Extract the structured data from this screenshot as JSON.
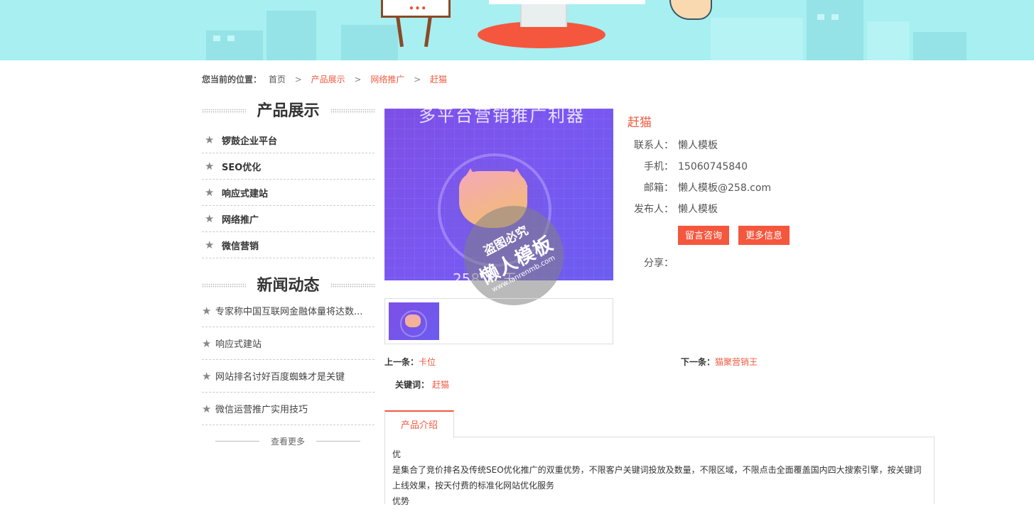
{
  "breadcrumb": {
    "label": "您当前的位置：",
    "items": [
      "首页",
      "产品展示",
      "网络推广",
      "赶猫"
    ],
    "separator": ">"
  },
  "sidebar": {
    "products_title": "产品展示",
    "products": [
      "锣鼓企业平台",
      "SEO优化",
      "响应式建站",
      "网络推广",
      "微信营销"
    ],
    "news_title": "新闻动态",
    "news": [
      "专家称中国互联网金融体量将达数...",
      "响应式建站",
      "网站排名讨好百度蜘蛛才是关键",
      "微信运营推广实用技巧"
    ],
    "more_label": "查看更多"
  },
  "product": {
    "image_top_text": "多平台营销推广利器",
    "image_bottom_text": "258 ... 王",
    "watermark": {
      "line1": "盗图必究",
      "line2": "懒人模板",
      "line3": "www.lanrenmb.com"
    },
    "title": "赶猫",
    "fields": [
      {
        "key": "联系人：",
        "value": "懒人模板"
      },
      {
        "key": "手机：",
        "value": "15060745840"
      },
      {
        "key": "邮箱：",
        "value": "懒人模板@258.com"
      },
      {
        "key": "发布人：",
        "value": "懒人模板"
      }
    ],
    "buttons": {
      "consult": "留言咨询",
      "more_info": "更多信息"
    },
    "share_label": "分享："
  },
  "navigation": {
    "prev_label": "上一条：",
    "prev_value": "卡位",
    "next_label": "下一条：",
    "next_value": "猫聚营销王"
  },
  "keywords": {
    "label": "关键词：",
    "value": "赶猫"
  },
  "tabs": [
    {
      "label": "产品介绍"
    }
  ],
  "description": [
    "优",
    " 是集合了竞价排名及传统SEO优化推广的双重优势，不限客户关键词投放及数量，不限区域，不限点击全面覆盖国内四大搜索引擎，按关键词上线效果，按天付费的标准化网站优化服务",
    "优势"
  ],
  "colors": {
    "accent": "#f05a40",
    "button": "#f4573e",
    "banner_bg": "#a7eff1"
  }
}
